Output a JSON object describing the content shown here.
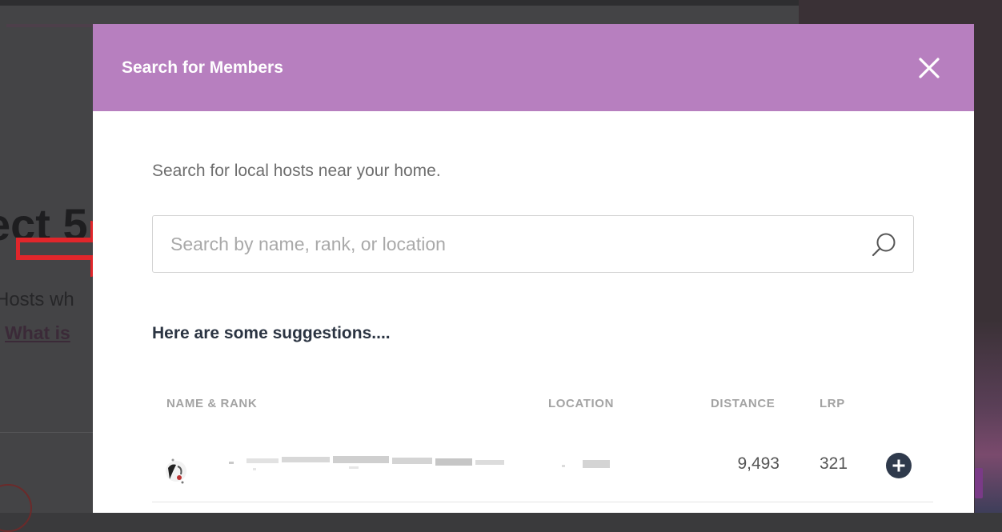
{
  "background": {
    "heading_fragment": "ect 5",
    "subtext_fragment": "Hosts wh",
    "link_fragment": "What is"
  },
  "modal": {
    "title": "Search for Members",
    "intro": "Search for local hosts near your home.",
    "search": {
      "placeholder": "Search by name, rank, or location",
      "value": ""
    },
    "suggestions_heading": "Here are some suggestions....",
    "table": {
      "columns": [
        "NAME & RANK",
        "LOCATION",
        "DISTANCE",
        "LRP"
      ],
      "rows": [
        {
          "distance": "9,493",
          "lrp": "321"
        }
      ]
    }
  },
  "colors": {
    "header_bg": "#b77fbf",
    "heading_text": "#2b3442",
    "annotation_arrow": "#e0262b"
  },
  "icons": {
    "close": "close-icon",
    "search": "search-icon",
    "add": "plus-circle-icon",
    "annotation": "arrow-right-icon"
  }
}
